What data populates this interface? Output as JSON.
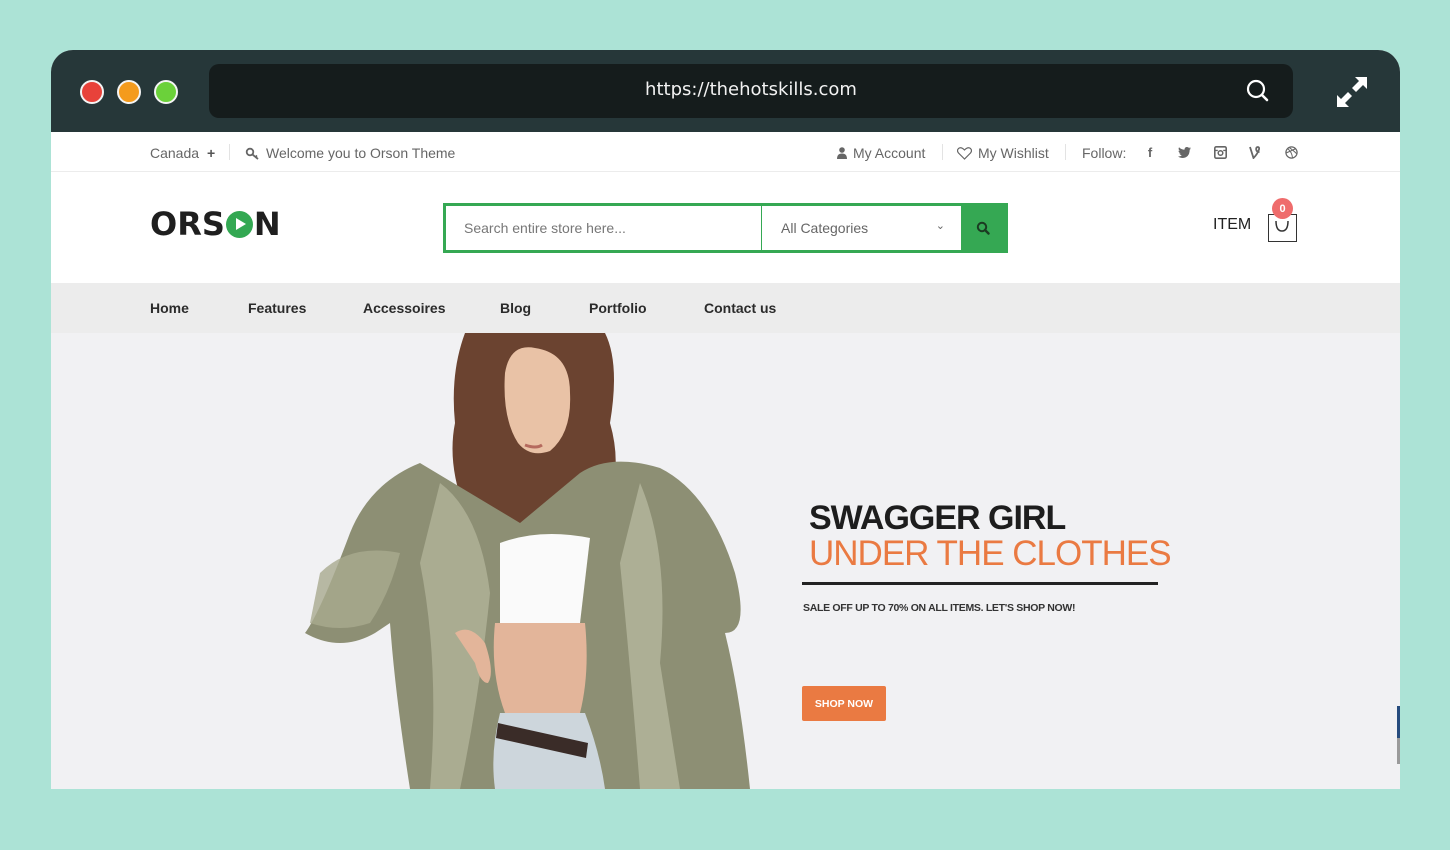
{
  "browser": {
    "url": "https://thehotskills.com",
    "traffic_lights": [
      "close",
      "minimize",
      "maximize"
    ],
    "icons": {
      "search": "search-icon",
      "expand": "expand-icon"
    }
  },
  "topbar": {
    "country": "Canada",
    "country_toggle": "+",
    "welcome": "Welcome you to Orson Theme",
    "account": "My Account",
    "wishlist": "My Wishlist",
    "follow": "Follow:",
    "socials": [
      "facebook",
      "twitter",
      "instagram",
      "vine",
      "dribbble"
    ]
  },
  "header": {
    "logo_left": "ORS",
    "logo_right": "N",
    "search_placeholder": "Search entire store here...",
    "category_selected": "All Categories",
    "cart_label": "ITEM",
    "cart_count": "0",
    "accent": "#35a853"
  },
  "nav": {
    "items": [
      "Home",
      "Features",
      "Accessoires",
      "Blog",
      "Portfolio",
      "Contact us"
    ]
  },
  "hero": {
    "title_line1": "SWAGGER GIRL",
    "title_line2": "UNDER THE CLOTHES",
    "subtitle": "SALE OFF UP TO 70% ON ALL ITEMS. LET'S SHOP NOW!",
    "cta": "SHOP NOW",
    "accent": "#ea7a42"
  }
}
